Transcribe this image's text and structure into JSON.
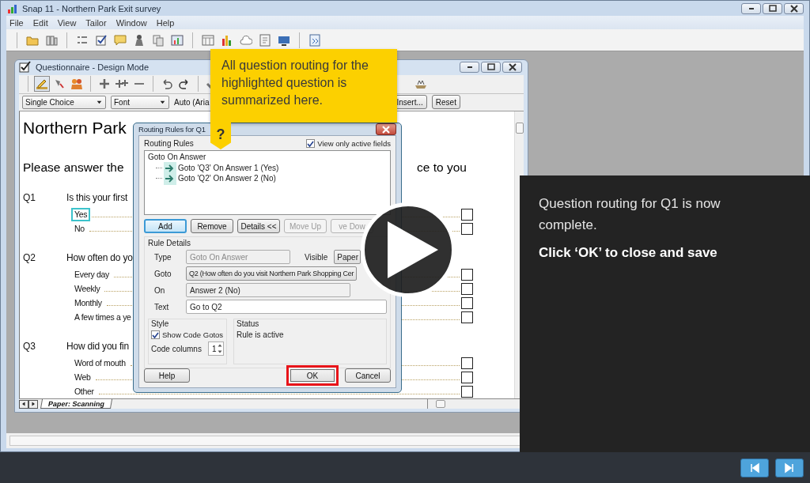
{
  "window": {
    "title": "Snap 11 - Northern Park Exit survey"
  },
  "menu": [
    "File",
    "Edit",
    "View",
    "Tailor",
    "Window",
    "Help"
  ],
  "questionnaire": {
    "title": "Questionnaire - Design Mode",
    "question_type": "Single Choice",
    "font": "Font",
    "font_name": "Auto (Aria",
    "format_buttons": [
      "Insert...",
      "Reset"
    ],
    "heading": "Northern Park",
    "instruction_start": "Please answer the",
    "instruction_end": "ce to you",
    "questions": [
      {
        "number": "Q1",
        "text": "Is this your first",
        "answers": [
          {
            "label": "Yes",
            "selected": true,
            "checked": false
          },
          {
            "label": "No",
            "selected": false,
            "checked": false
          }
        ]
      },
      {
        "number": "Q2",
        "text": "How often do yo",
        "answers": [
          {
            "label": "Every day",
            "selected": false,
            "checked": false
          },
          {
            "label": "Weekly",
            "selected": false,
            "checked": false
          },
          {
            "label": "Monthly",
            "selected": false,
            "checked": false
          },
          {
            "label": "A few times a ye",
            "selected": false,
            "checked": false
          }
        ]
      },
      {
        "number": "Q3",
        "text": "How did you fin",
        "answers": [
          {
            "label": "Word of mouth",
            "selected": false,
            "checked": false
          },
          {
            "label": "Web",
            "selected": false,
            "checked": false
          },
          {
            "label": "Other",
            "selected": false,
            "checked": false
          }
        ]
      }
    ],
    "sheet_tab": "Paper: Scanning"
  },
  "dialog": {
    "title": "Routing Rules for Q1",
    "rules_label": "Routing Rules",
    "active_only": {
      "label": "View only active fields",
      "checked": true
    },
    "rules": [
      {
        "label": "Goto On Answer",
        "children": [
          {
            "label": "Goto 'Q3' On Answer 1 (Yes)"
          },
          {
            "label": "Goto 'Q2' On Answer 2 (No)"
          }
        ]
      }
    ],
    "buttons": [
      {
        "label": "Add",
        "focused": true,
        "disabled": false
      },
      {
        "label": "Remove",
        "focused": false,
        "disabled": false
      },
      {
        "label": "Details <<",
        "focused": false,
        "disabled": false
      },
      {
        "label": "Move Up",
        "focused": false,
        "disabled": true
      },
      {
        "label": "ve Dow",
        "focused": false,
        "disabled": true
      }
    ],
    "details_label": "Rule Details",
    "type_label": "Type",
    "type_value": "Goto On Answer",
    "visible_label": "Visible",
    "visible_value": "Paper",
    "goto_label": "Goto",
    "goto_value": "Q2  (How often do you visit Northern Park Shopping Cer",
    "on_label": "On",
    "on_value": "Answer 2 (No)",
    "text_label": "Text",
    "text_value": "Go to Q2",
    "style_label": "Style",
    "show_gotos": {
      "label": "Show Code Gotos",
      "checked": true
    },
    "columns_label": "Code columns",
    "columns_value": "1",
    "status_label": "Status",
    "status_value": "Rule is active",
    "footer_buttons": [
      {
        "label": "Help",
        "highlighted": false
      },
      {
        "label": "OK",
        "highlighted": true
      },
      {
        "label": "Cancel",
        "highlighted": false
      }
    ]
  },
  "callout": {
    "text": "All question routing for the highlighted question is summarized here.",
    "marker": "?"
  },
  "panel": {
    "message": "Question routing for Q1 is now complete.",
    "instruction": "Click ‘OK’ to close and save"
  }
}
